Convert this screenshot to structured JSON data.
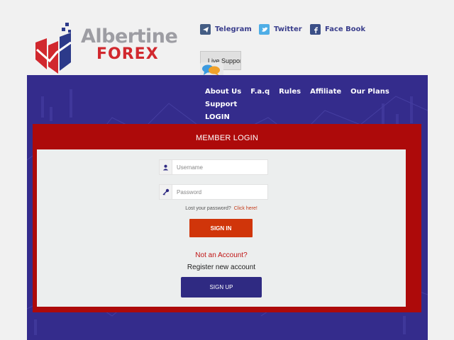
{
  "brand": {
    "name_line1": "Albertine",
    "name_line2": "FOREX"
  },
  "social": [
    {
      "label": "Telegram",
      "icon": "telegram-icon",
      "color": "#445d84"
    },
    {
      "label": "Twitter",
      "icon": "twitter-icon",
      "color": "#4faee6"
    },
    {
      "label": "Face Book",
      "icon": "facebook-icon",
      "color": "#3b4f87"
    }
  ],
  "live_support": {
    "label": "Live Support"
  },
  "nav": {
    "items": [
      "About Us",
      "F.a.q",
      "Rules",
      "Affiliate",
      "Our Plans",
      "Support",
      "LOGIN"
    ]
  },
  "login": {
    "title": "MEMBER LOGIN",
    "username": {
      "placeholder": "Username",
      "value": ""
    },
    "password": {
      "placeholder": "Password",
      "value": ""
    },
    "lost_text": "Lost your password?",
    "lost_link": "Click here!",
    "signin_label": "SIGN IN",
    "not_account": "Not an Account?",
    "register_text": "Register new account",
    "signup_label": "SIGN UP"
  },
  "colors": {
    "banner": "#342c8c",
    "panel_frame": "#ad0a0a",
    "signin_button": "#d0350a",
    "signup_button": "#2f2a82"
  }
}
